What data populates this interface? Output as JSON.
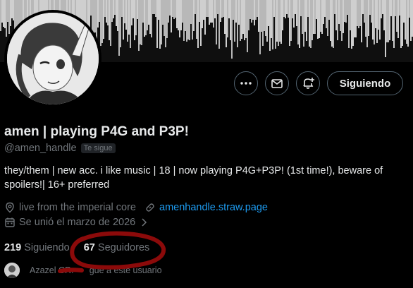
{
  "profile": {
    "display_name": "amen | playing P4G and P3P!",
    "handle": "@amen_handle",
    "follows_you_badge": "Te sigue",
    "bio": "they/them | new acc. i like music | 18 | now playing P4G+P3P! (1st time!), beware of spoilers!| 16+ preferred",
    "location": "live from the imperial core",
    "website": "amenhandle.straw.page",
    "joined": "Se unió el marzo de 2026",
    "following_count": "219",
    "following_label": "Siguiendo",
    "followers_count": "67",
    "followers_label": "Seguidores",
    "followed_by_text": "Azazel CR:-",
    "followed_by_suffix": "gue a este usuario"
  },
  "actions": {
    "follow_button": "Siguiendo",
    "more_icon": "more-icon",
    "message_icon": "envelope-icon",
    "notify_icon": "bell-plus-icon"
  },
  "colors": {
    "accent": "#1d9bf0",
    "secondary_text": "#71767b",
    "annotation": "#8b0a0a"
  }
}
